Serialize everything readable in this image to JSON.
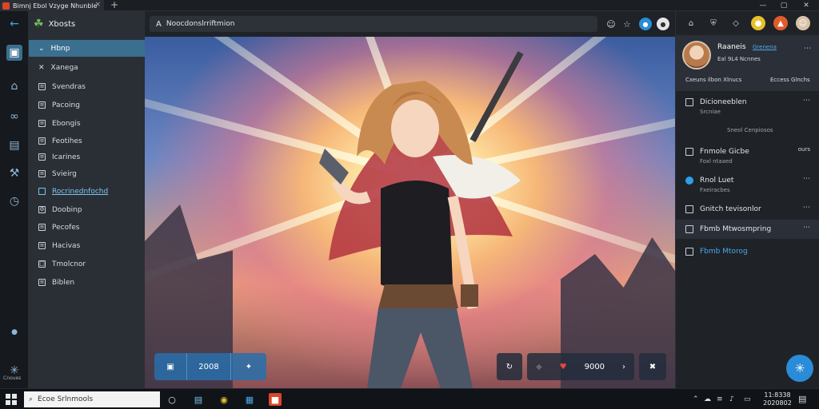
{
  "window": {
    "tab_title": "Bimnj Ebol Vzyge Nhunble",
    "new_tab": "+",
    "tab_close": "×",
    "minimize": "—",
    "maximize": "▢",
    "close": "✕"
  },
  "rail": {
    "bottom_label": "Cnoues"
  },
  "sidebar": {
    "brand": "Xbosts",
    "items": [
      {
        "label": "Hbnp",
        "icon": "chevron-icon"
      },
      {
        "label": "Xanega",
        "icon": "close-icon"
      },
      {
        "label": "Svendras",
        "icon": "list-icon"
      },
      {
        "label": "Pacoing",
        "icon": "list-icon"
      },
      {
        "label": "Ebongis",
        "icon": "list-icon"
      },
      {
        "label": "Feotihes",
        "icon": "list-icon"
      },
      {
        "label": "Icarines",
        "icon": "list-icon"
      },
      {
        "label": "Svieirg",
        "icon": "list-icon"
      },
      {
        "label": "Rocrinednfochd",
        "icon": "square-icon"
      },
      {
        "label": "Doobinp",
        "icon": "gear-icon"
      },
      {
        "label": "Pecofes",
        "icon": "list-icon"
      },
      {
        "label": "Hacivas",
        "icon": "list-icon"
      },
      {
        "label": "Tmolcnor",
        "icon": "lock-icon"
      },
      {
        "label": "Biblen",
        "icon": "list-icon"
      }
    ]
  },
  "address": {
    "url": "Noocdonslrriftmion"
  },
  "artwork": {
    "stat_left_value": "2008",
    "stat_right_value": "9000"
  },
  "right_panel": {
    "profile_name": "Raaneis",
    "profile_tag": "Grenena",
    "profile_sub": "Eal 9L4 Ncnnes",
    "profile_meta_left": "Cxeuns ilbon Xlnucs",
    "profile_meta_right": "Eccess Glnchs",
    "items": [
      {
        "label": "Dicioneeblen",
        "sub": "Srcniae",
        "checked": false
      },
      {
        "label": "Sneol Cenpiosos",
        "sub": "",
        "checked": false,
        "divider": true
      },
      {
        "label": "Fnmole Gicbe",
        "sub": "Foxl ntaaed",
        "checked": false,
        "badge": "ours"
      },
      {
        "label": "Rnol Luet",
        "sub": "Fxeiracbes",
        "checked": true
      },
      {
        "label": "Gnitch tevisonlor",
        "sub": "",
        "checked": false
      },
      {
        "label": "Fbmb Mtwosmpring",
        "sub": "",
        "checked": false
      },
      {
        "label": "Fbmb Mtorog",
        "sub": "",
        "checked": false,
        "accent": true
      }
    ]
  },
  "taskbar": {
    "search_placeholder": "Ecoe Srlnmools",
    "time": "11:8338",
    "date": "2020802"
  }
}
